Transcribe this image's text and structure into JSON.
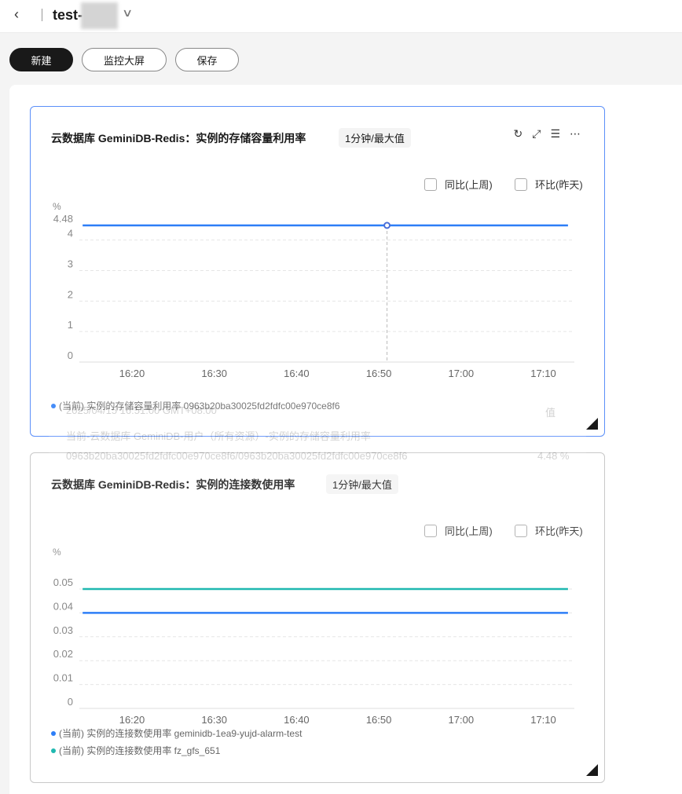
{
  "header": {
    "back_icon": "chevron-left-icon",
    "title": "test-",
    "dropdown_icon": "chevron-down-icon"
  },
  "toolbar": {
    "new_label": "新建",
    "monitor_label": "监控大屏",
    "save_label": "保存"
  },
  "tools": {
    "refresh": "refresh-icon",
    "fullscreen": "expand-icon",
    "list": "list-icon",
    "more": "more-icon"
  },
  "compare": {
    "yoy": "同比(上周)",
    "dod": "环比(昨天)"
  },
  "tooltip": {
    "time": "2025/04/15 16:51:00 GMT+08:00",
    "value_header": "值",
    "group": "当前-云数据库 GeminiDB-用户（所有资源）-实例的存储容量利用率",
    "series": "0963b20ba30025fd2fdfc00e970ce8f6/0963b20ba30025fd2fdfc00e970ce8f6",
    "value": "4.48 %"
  },
  "chart_data": [
    {
      "type": "line",
      "title": "云数据库 GeminiDB-Redis：实例的存储容量利用率",
      "aggregation": "1分钟/最大值",
      "ylabel": "%",
      "ylim": [
        0,
        4.48
      ],
      "yticks": [
        "0",
        "1",
        "2",
        "3",
        "4",
        "4.48"
      ],
      "ytick_values": [
        0,
        1,
        2,
        3,
        4,
        4.48
      ],
      "xticks": [
        "16:20",
        "16:30",
        "16:40",
        "16:50",
        "17:00",
        "17:10"
      ],
      "xlim": [
        "16:14",
        "17:13"
      ],
      "hover_x": "16:51",
      "series": [
        {
          "name": "(当前) 实例的存储容量利用率 0963b20ba30025fd2fdfc00e970ce8f6",
          "color": "#2d7ef7",
          "values": [
            {
              "x": "16:14",
              "y": 4.48
            },
            {
              "x": "17:13",
              "y": 4.48
            }
          ]
        }
      ]
    },
    {
      "type": "line",
      "title": "云数据库 GeminiDB-Redis：实例的连接数使用率",
      "aggregation": "1分钟/最大值",
      "ylabel": "%",
      "ylim": [
        0,
        0.05
      ],
      "yticks": [
        "0",
        "0.01",
        "0.02",
        "0.03",
        "0.04",
        "0.05"
      ],
      "ytick_values": [
        0,
        0.01,
        0.02,
        0.03,
        0.04,
        0.05
      ],
      "xticks": [
        "16:20",
        "16:30",
        "16:40",
        "16:50",
        "17:00",
        "17:10"
      ],
      "xlim": [
        "16:14",
        "17:13"
      ],
      "series": [
        {
          "name": "(当前) 实例的连接数使用率 geminidb-1ea9-yujd-alarm-test",
          "color": "#2d7ef7",
          "values": [
            {
              "x": "16:14",
              "y": 0.04
            },
            {
              "x": "17:13",
              "y": 0.04
            }
          ]
        },
        {
          "name": "(当前) 实例的连接数使用率 fz_gfs_651",
          "color": "#1fb8b0",
          "values": [
            {
              "x": "16:14",
              "y": 0.05
            },
            {
              "x": "17:13",
              "y": 0.05
            }
          ]
        }
      ]
    }
  ]
}
